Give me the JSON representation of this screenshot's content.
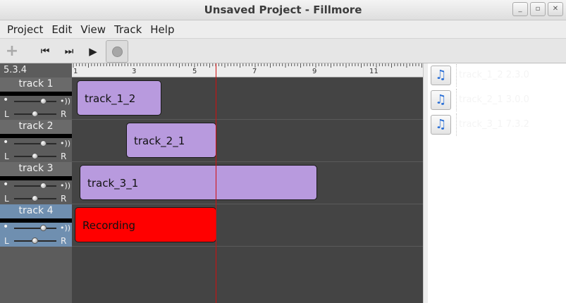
{
  "window": {
    "title": "Unsaved Project - Fillmore",
    "buttons": [
      "_",
      "▫",
      "✕"
    ]
  },
  "menu": [
    "Project",
    "Edit",
    "View",
    "Track",
    "Help"
  ],
  "toolbar": {
    "add_label": "+",
    "start_label": "⏮",
    "end_label": "⏭",
    "play_label": "▶"
  },
  "time_readout": "5.3.4",
  "tracks": [
    {
      "name": "track 1",
      "pan_left": "L",
      "pan_right": "R",
      "volume_icon": "•))",
      "volume_level": 0.7,
      "pan_level": 0.5
    },
    {
      "name": "track 2",
      "pan_left": "L",
      "pan_right": "R",
      "volume_icon": "•))",
      "volume_level": 0.7,
      "pan_level": 0.5
    },
    {
      "name": "track 3",
      "pan_left": "L",
      "pan_right": "R",
      "volume_icon": "•))",
      "volume_level": 0.7,
      "pan_level": 0.5
    },
    {
      "name": "track 4",
      "pan_left": "L",
      "pan_right": "R",
      "volume_icon": "•))",
      "volume_level": 0.7,
      "pan_level": 0.5
    }
  ],
  "ruler": {
    "labels": [
      "1",
      "3",
      "5",
      "7",
      "9",
      "11"
    ]
  },
  "clips": [
    {
      "name": "track_1_2"
    },
    {
      "name": "track_2_1"
    },
    {
      "name": "track_3_1"
    },
    {
      "name": "Recording"
    }
  ],
  "library": [
    {
      "name": "track_1_2  2.3.0",
      "icon": "music-note-icon"
    },
    {
      "name": "track_2_1  3.0.0",
      "icon": "music-note-icon"
    },
    {
      "name": "track_3_1  7.3.2",
      "icon": "music-note-icon"
    }
  ],
  "colors": {
    "clip": "#b89ade",
    "recording_clip": "#ff0000",
    "playhead": "#d01010",
    "selected_track": "#6f8fb0"
  }
}
